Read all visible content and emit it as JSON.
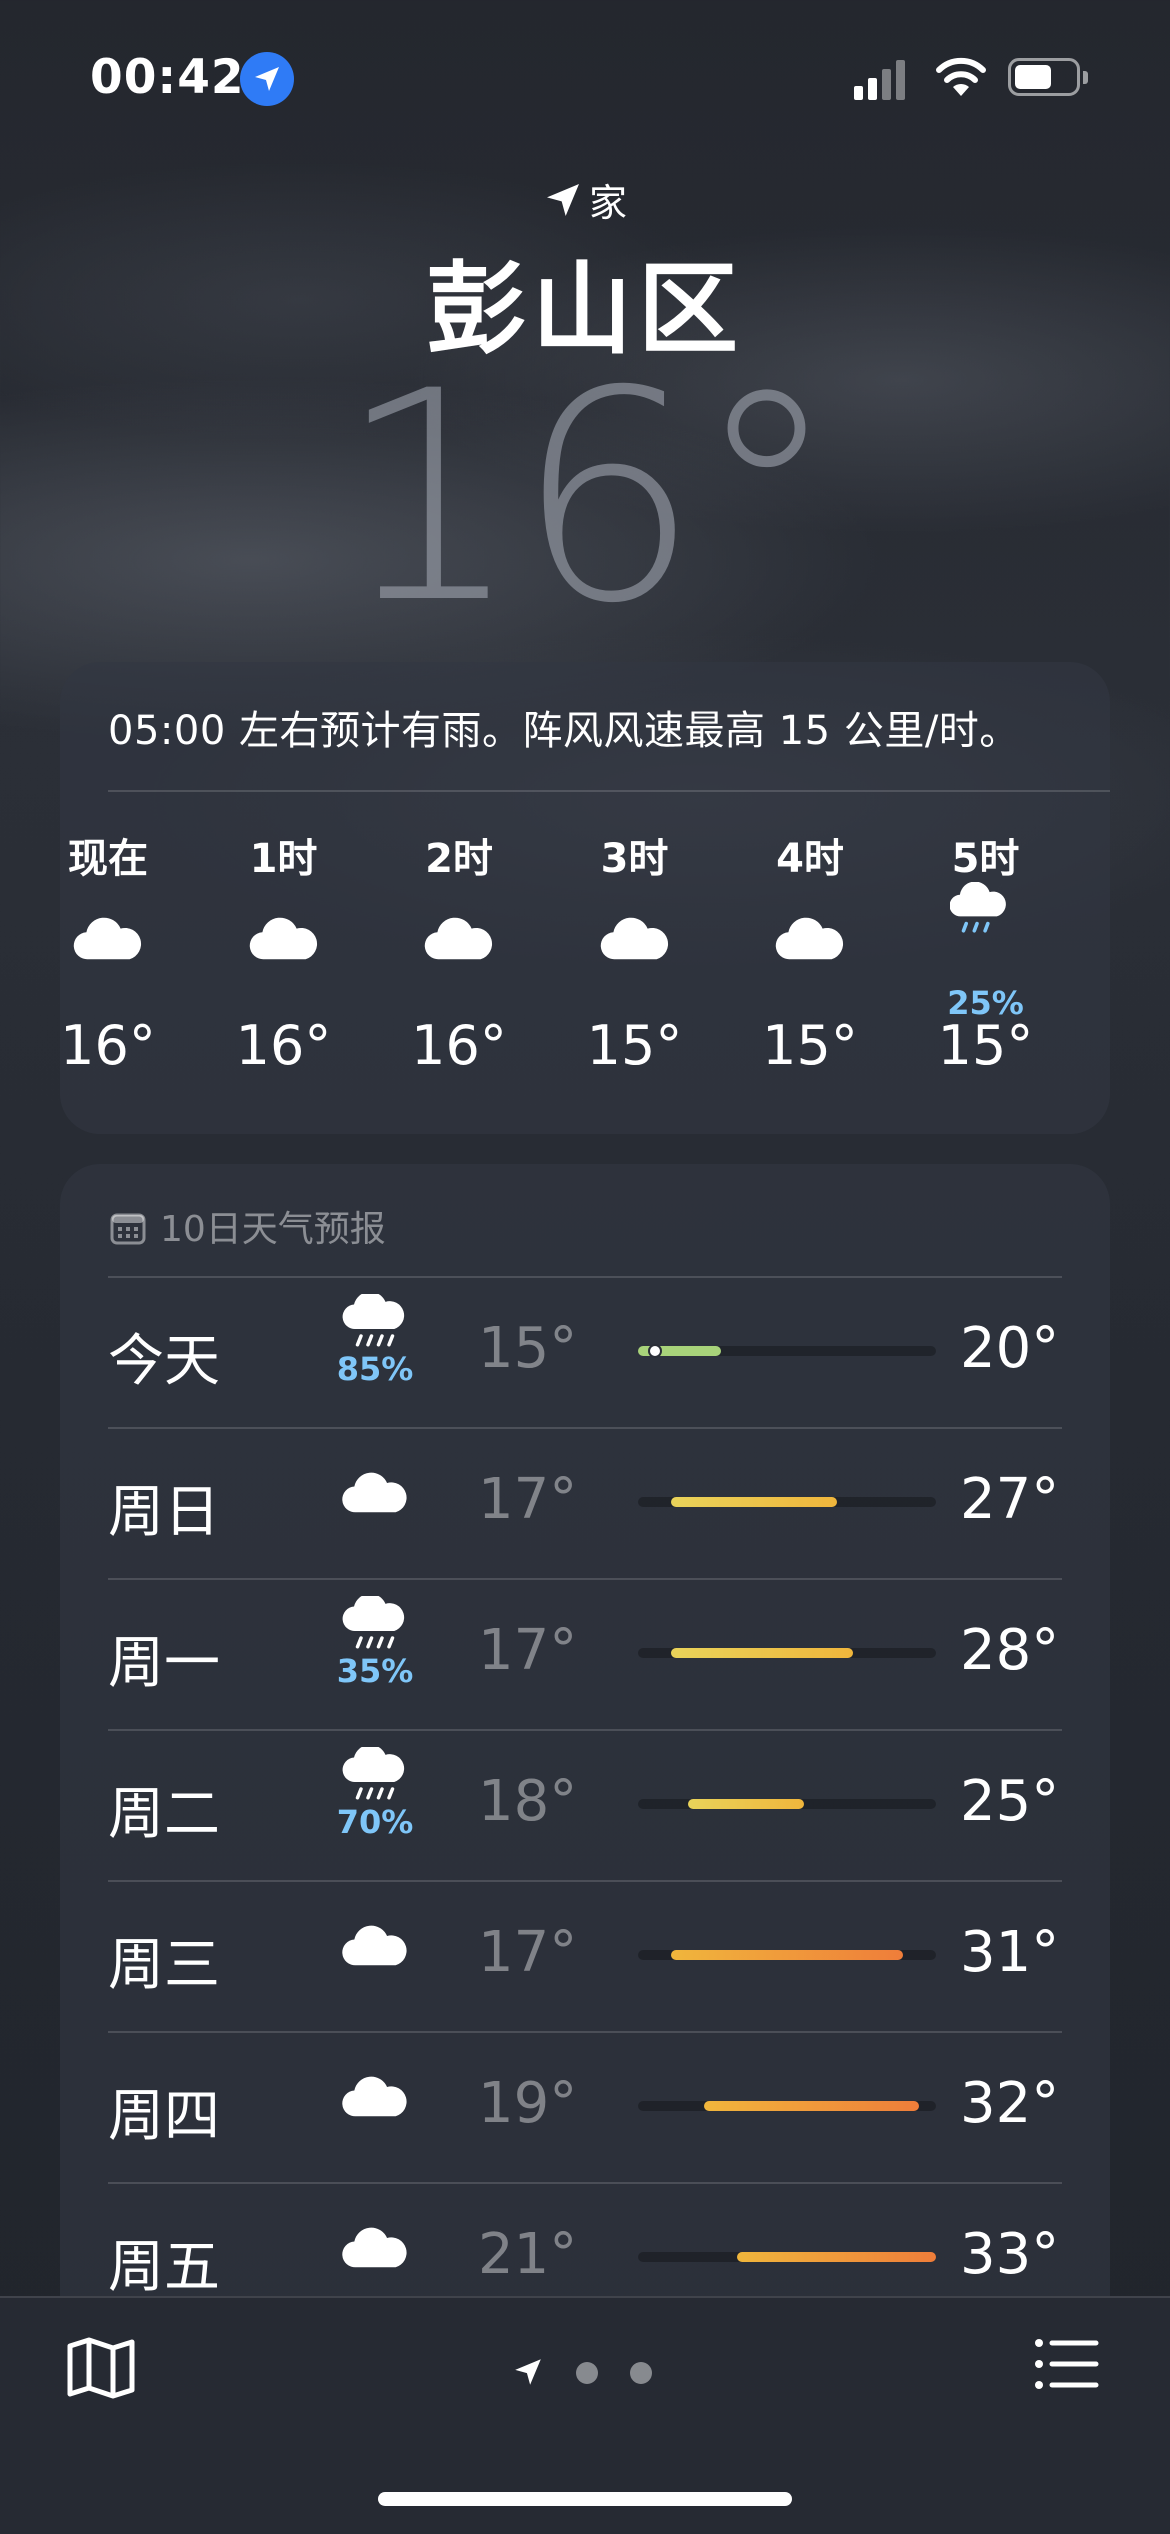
{
  "status_bar": {
    "time": "00:42"
  },
  "header": {
    "home_label": "家",
    "city": "彭山区",
    "current_temp": "16°"
  },
  "hourly": {
    "summary": "05:00 左右预计有雨。阵风风速最高 15 公里/时。",
    "items": [
      {
        "label": "现在",
        "icon": "cloud-icon",
        "temp": "16°",
        "precip": ""
      },
      {
        "label": "1时",
        "icon": "cloud-icon",
        "temp": "16°",
        "precip": ""
      },
      {
        "label": "2时",
        "icon": "cloud-icon",
        "temp": "16°",
        "precip": ""
      },
      {
        "label": "3时",
        "icon": "cloud-icon",
        "temp": "15°",
        "precip": ""
      },
      {
        "label": "4时",
        "icon": "cloud-icon",
        "temp": "15°",
        "precip": ""
      },
      {
        "label": "5时",
        "icon": "cloud-moon-rain-icon",
        "temp": "15°",
        "precip": "25%"
      }
    ]
  },
  "daily": {
    "title": "10日天气预报",
    "range": {
      "min": 15,
      "max": 33
    },
    "current_temp": 16,
    "days": [
      {
        "name": "今天",
        "icon": "cloud-rain-icon",
        "precip": "85%",
        "low": "15°",
        "high": "20°",
        "low_value": 15,
        "high_value": 20
      },
      {
        "name": "周日",
        "icon": "cloud-icon",
        "precip": "",
        "low": "17°",
        "high": "27°",
        "low_value": 17,
        "high_value": 27
      },
      {
        "name": "周一",
        "icon": "cloud-rain-icon",
        "precip": "35%",
        "low": "17°",
        "high": "28°",
        "low_value": 17,
        "high_value": 28
      },
      {
        "name": "周二",
        "icon": "cloud-rain-icon",
        "precip": "70%",
        "low": "18°",
        "high": "25°",
        "low_value": 18,
        "high_value": 25
      },
      {
        "name": "周三",
        "icon": "cloud-icon",
        "precip": "",
        "low": "17°",
        "high": "31°",
        "low_value": 17,
        "high_value": 31
      },
      {
        "name": "周四",
        "icon": "cloud-icon",
        "precip": "",
        "low": "19°",
        "high": "32°",
        "low_value": 19,
        "high_value": 32
      },
      {
        "name": "周五",
        "icon": "cloud-icon",
        "precip": "",
        "low": "21°",
        "high": "33°",
        "low_value": 21,
        "high_value": 33
      }
    ]
  },
  "colors": {
    "precip": "#7fc6f8",
    "location_pill": "#2f7bf6",
    "bar_cool": "#a8d37a",
    "bar_mild": "#e9d35a",
    "bar_warm": "#f0b63c",
    "bar_hot": "#ef7d3a"
  },
  "toolbar": {
    "page_count": 3,
    "active_page": 0
  }
}
